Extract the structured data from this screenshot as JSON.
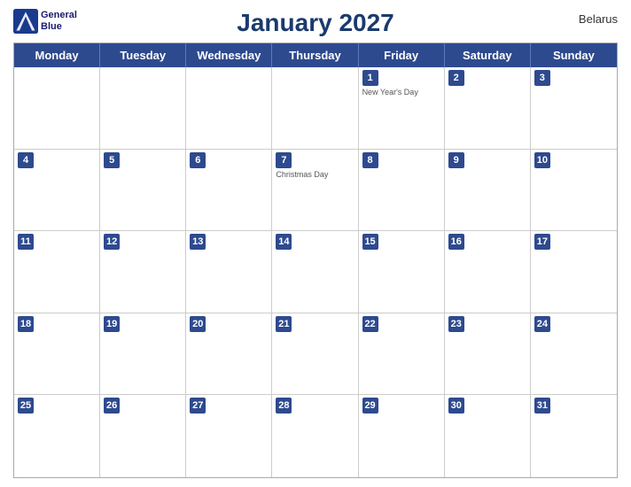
{
  "header": {
    "title": "January 2027",
    "country": "Belarus",
    "logo_line1": "General",
    "logo_line2": "Blue"
  },
  "days_of_week": [
    "Monday",
    "Tuesday",
    "Wednesday",
    "Thursday",
    "Friday",
    "Saturday",
    "Sunday"
  ],
  "weeks": [
    [
      {
        "date": "",
        "empty": true
      },
      {
        "date": "",
        "empty": true
      },
      {
        "date": "",
        "empty": true
      },
      {
        "date": "",
        "empty": true
      },
      {
        "date": "1",
        "holiday": "New Year's Day"
      },
      {
        "date": "2"
      },
      {
        "date": "3"
      }
    ],
    [
      {
        "date": "4"
      },
      {
        "date": "5"
      },
      {
        "date": "6"
      },
      {
        "date": "7",
        "holiday": "Christmas Day"
      },
      {
        "date": "8"
      },
      {
        "date": "9"
      },
      {
        "date": "10"
      }
    ],
    [
      {
        "date": "11"
      },
      {
        "date": "12"
      },
      {
        "date": "13"
      },
      {
        "date": "14"
      },
      {
        "date": "15"
      },
      {
        "date": "16"
      },
      {
        "date": "17"
      }
    ],
    [
      {
        "date": "18"
      },
      {
        "date": "19"
      },
      {
        "date": "20"
      },
      {
        "date": "21"
      },
      {
        "date": "22"
      },
      {
        "date": "23"
      },
      {
        "date": "24"
      }
    ],
    [
      {
        "date": "25"
      },
      {
        "date": "26"
      },
      {
        "date": "27"
      },
      {
        "date": "28"
      },
      {
        "date": "29"
      },
      {
        "date": "30"
      },
      {
        "date": "31"
      }
    ]
  ]
}
